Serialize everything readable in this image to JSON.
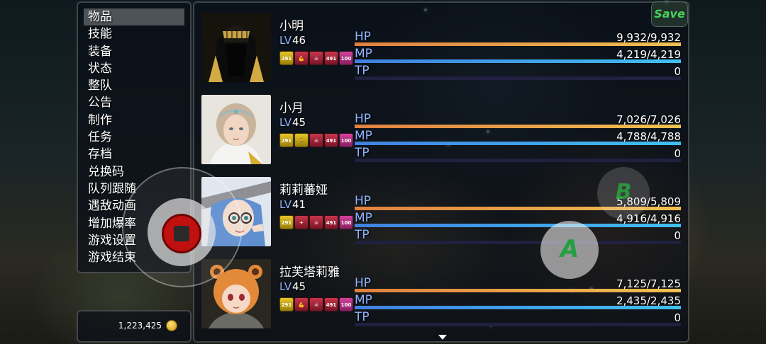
{
  "menu": {
    "items": [
      {
        "label": "物品",
        "selected": true
      },
      {
        "label": "技能",
        "selected": false
      },
      {
        "label": "装备",
        "selected": false
      },
      {
        "label": "状态",
        "selected": false
      },
      {
        "label": "整队",
        "selected": false
      },
      {
        "label": "公告",
        "selected": false
      },
      {
        "label": "制作",
        "selected": false
      },
      {
        "label": "任务",
        "selected": false
      },
      {
        "label": "存档",
        "selected": false
      },
      {
        "label": "兑换码",
        "selected": false
      },
      {
        "label": "队列跟随",
        "selected": false
      },
      {
        "label": "遇敌动画",
        "selected": false
      },
      {
        "label": "增加爆率",
        "selected": false
      },
      {
        "label": "游戏设置",
        "selected": false
      },
      {
        "label": "游戏结束",
        "selected": false
      }
    ]
  },
  "gold": {
    "amount": "1,223,425",
    "icon": "coin-icon"
  },
  "labels": {
    "lv": "LV",
    "hp": "HP",
    "mp": "MP",
    "tp": "TP"
  },
  "actors": [
    {
      "name": "小明",
      "level": "46",
      "states": [
        "291",
        "muscle",
        "skull",
        "491",
        "100"
      ],
      "hp": "9,932/9,932",
      "hp_ratio": 1.0,
      "mp": "4,219/4,219",
      "mp_ratio": 1.0,
      "tp": "0",
      "tp_ratio": 0,
      "portrait": "hooded-figure"
    },
    {
      "name": "小月",
      "level": "45",
      "states": [
        "291",
        "runner",
        "skull",
        "491",
        "100"
      ],
      "hp": "7,026/7,026",
      "hp_ratio": 1.0,
      "mp": "4,788/4,788",
      "mp_ratio": 1.0,
      "tp": "0",
      "tp_ratio": 0,
      "portrait": "circlet-girl"
    },
    {
      "name": "莉莉蕃娅",
      "level": "41",
      "states": [
        "291",
        "wings",
        "skull",
        "491",
        "100"
      ],
      "hp": "5,809/5,809",
      "hp_ratio": 1.0,
      "mp": "4,916/4,916",
      "mp_ratio": 1.0,
      "tp": "0",
      "tp_ratio": 0,
      "portrait": "witch-girl"
    },
    {
      "name": "拉芙塔莉雅",
      "level": "45",
      "states": [
        "291",
        "muscle",
        "skull",
        "491",
        "100"
      ],
      "hp": "7,125/7,125",
      "hp_ratio": 1.0,
      "mp": "2,435/2,435",
      "mp_ratio": 1.0,
      "tp": "0",
      "tp_ratio": 0,
      "portrait": "raccoon-girl"
    }
  ],
  "controls": {
    "save_label": "Save",
    "a_label": "A",
    "b_label": "B"
  },
  "colors": {
    "lv_label": "#8fb4ff",
    "hp_bar": "#e08040",
    "mp_bar": "#4080e0",
    "window_bg": "#0a0e16"
  }
}
